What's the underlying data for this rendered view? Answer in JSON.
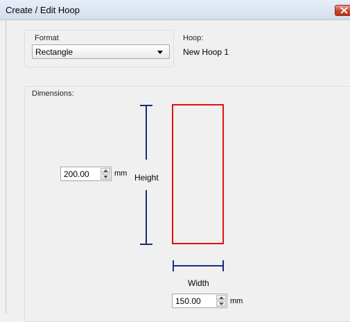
{
  "window": {
    "title": "Create / Edit Hoop"
  },
  "format": {
    "label": "Format",
    "selected": "Rectangle"
  },
  "hoop": {
    "label": "Hoop:",
    "name": "New Hoop 1"
  },
  "dimensions": {
    "label": "Dimensions:",
    "height": {
      "label": "Height",
      "value": "200.00",
      "unit": "mm"
    },
    "width": {
      "label": "Width",
      "value": "150.00",
      "unit": "mm"
    }
  },
  "colors": {
    "shape_outline": "#e01010",
    "dimension_line": "#1a2a7a"
  },
  "icons": {
    "close": "close-icon",
    "dropdown": "chevron-down-icon",
    "spin_up": "arrow-up-icon",
    "spin_down": "arrow-down-icon"
  }
}
